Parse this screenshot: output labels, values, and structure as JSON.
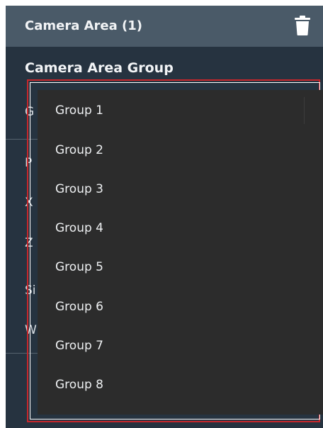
{
  "header": {
    "title": "Camera Area (1)",
    "delete_icon": "trash-icon"
  },
  "section": {
    "title": "Camera Area Group"
  },
  "background_fields": [
    "G",
    "P",
    "X",
    "Z",
    "Si",
    "W"
  ],
  "dropdown": {
    "options": [
      "Group 1",
      "Group 2",
      "Group 3",
      "Group 4",
      "Group 5",
      "Group 6",
      "Group 7",
      "Group 8"
    ]
  },
  "colors": {
    "panel": "#263340",
    "header": "#4a5a68",
    "dropdown": "#2c2c2c",
    "focus_ring": "#c8272c"
  }
}
